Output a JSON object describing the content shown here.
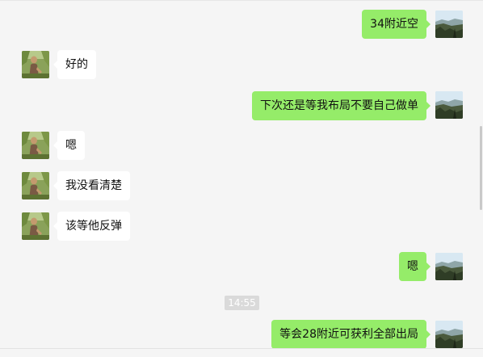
{
  "chat": {
    "messages": [
      {
        "side": "right",
        "text": "34附近空"
      },
      {
        "side": "left",
        "text": "好的"
      },
      {
        "side": "right",
        "text": "下次还是等我布局不要自己做单"
      },
      {
        "side": "left",
        "text": "嗯"
      },
      {
        "side": "left",
        "text": "我没看清楚"
      },
      {
        "side": "left",
        "text": "该等他反弹"
      },
      {
        "side": "right",
        "text": "嗯"
      },
      {
        "side": "right",
        "text": "等会28附近可获利全部出局"
      }
    ],
    "timestamp": "14:55"
  },
  "colors": {
    "background": "#f5f5f5",
    "sent_bubble": "#95ec69",
    "received_bubble": "#ffffff",
    "timestamp_bg": "#dadada"
  },
  "icons": {
    "contact_avatar": "contact-photo-avatar",
    "self_avatar": "self-landscape-avatar"
  }
}
